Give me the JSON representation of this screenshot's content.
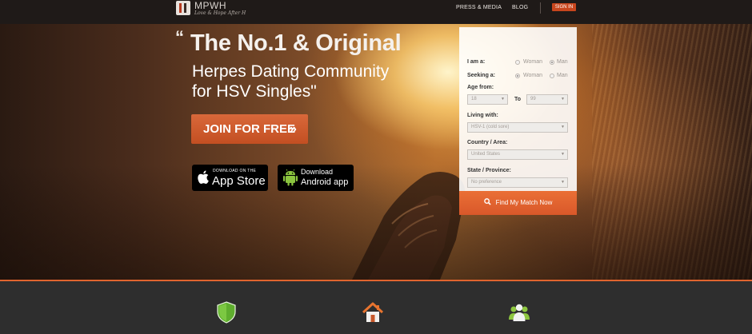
{
  "header": {
    "brand": "MPWH",
    "tagline": "Love & Hope After H",
    "nav": [
      {
        "label": "PRESS & MEDIA"
      },
      {
        "label": "BLOG"
      }
    ],
    "signin_label": "SIGN IN"
  },
  "hero": {
    "quote_open": "“",
    "headline_line1": "The No.1 & Original",
    "headline_line2": "Herpes Dating Community",
    "headline_line3": "for HSV Singles\"",
    "join_label": "JOIN FOR FREE",
    "join_arrows": "»",
    "app_store": {
      "small": "Download on the",
      "big": "App Store"
    },
    "android": {
      "small": "Download",
      "big": "Android app"
    }
  },
  "search": {
    "i_am_label": "I am a:",
    "seeking_label": "Seeking a:",
    "option_woman": "Woman",
    "option_man": "Man",
    "i_am_selected": "Man",
    "seeking_selected": "Woman",
    "age_label": "Age from:",
    "age_from": "18",
    "age_to_label": "To",
    "age_to": "99",
    "living_label": "Living with:",
    "living_value": "HSV-1 (cold sore)",
    "country_label": "Country / Area:",
    "country_value": "United States",
    "state_label": "State / Province:",
    "state_value": "No preference",
    "find_label": "Find My Match Now"
  },
  "features": {
    "icons": [
      "shield-icon",
      "home-icon",
      "community-icon"
    ]
  },
  "colors": {
    "accent": "#e0642e",
    "signin": "#c8461d",
    "bottom_bg": "#2e2e2e"
  }
}
